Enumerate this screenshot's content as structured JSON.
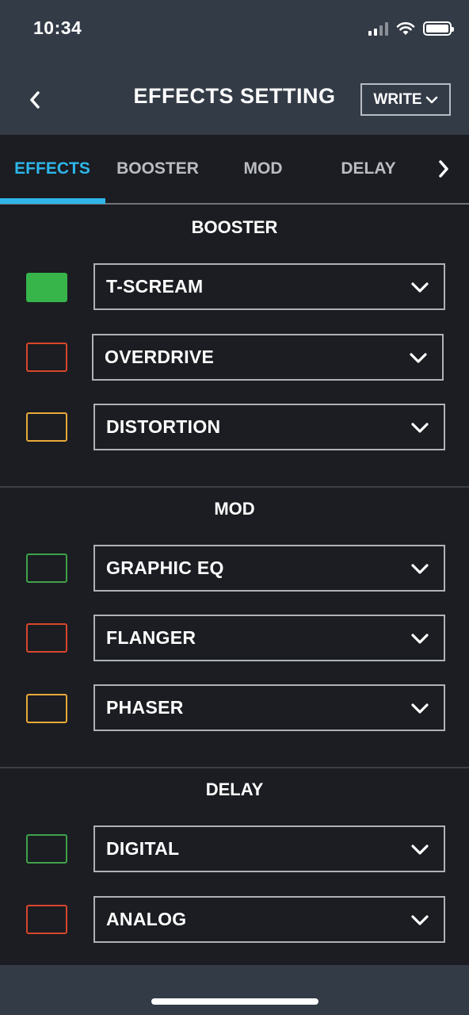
{
  "status_bar": {
    "time": "10:34"
  },
  "header": {
    "title": "EFFECTS SETTING",
    "write_label": "WRITE"
  },
  "tabs": [
    {
      "label": "EFFECTS",
      "active": true
    },
    {
      "label": "BOOSTER",
      "active": false
    },
    {
      "label": "MOD",
      "active": false
    },
    {
      "label": "DELAY",
      "active": false
    }
  ],
  "sections": {
    "booster": {
      "title": "BOOSTER",
      "items": [
        {
          "value": "T-SCREAM",
          "color": "#37b44a",
          "enabled": true
        },
        {
          "value": "OVERDRIVE",
          "color": "#d9462b",
          "enabled": false
        },
        {
          "value": "DISTORTION",
          "color": "#e9a93a",
          "enabled": false
        }
      ]
    },
    "mod": {
      "title": "MOD",
      "items": [
        {
          "value": "GRAPHIC EQ",
          "color": "#3fa24a",
          "enabled": false
        },
        {
          "value": "FLANGER",
          "color": "#d9462b",
          "enabled": false
        },
        {
          "value": "PHASER",
          "color": "#e9a93a",
          "enabled": false
        }
      ]
    },
    "delay": {
      "title": "DELAY",
      "items": [
        {
          "value": "DIGITAL",
          "color": "#3fa24a",
          "enabled": false
        },
        {
          "value": "ANALOG",
          "color": "#d9462b",
          "enabled": false
        }
      ]
    }
  },
  "colors": {
    "accent": "#2eb6ea",
    "header_bg": "#333b47",
    "body_bg": "#1b1d22"
  },
  "icons": {
    "back": "chevron-left-icon",
    "write_dropdown": "chevron-down-icon",
    "tabs_next": "chevron-right-icon",
    "select_dropdown": "chevron-down-icon"
  }
}
